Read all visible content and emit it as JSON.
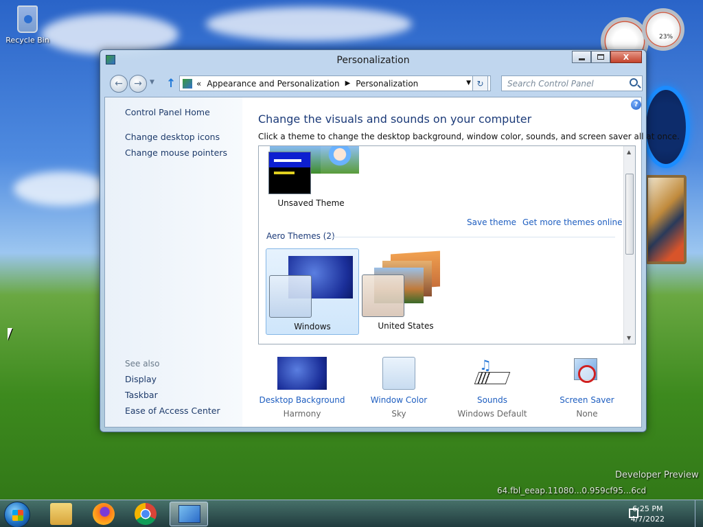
{
  "desktop": {
    "recycle_bin_label": "Recycle Bin",
    "watermark_line1": "Developer Preview",
    "watermark_line2": "64.fbl_eeap.11080...0.959cf95...6cd"
  },
  "window": {
    "title": "Personalization",
    "minimize_label": "▭",
    "maximize_label": "□",
    "close_label": "X"
  },
  "toolbar": {
    "back_icon": "back-arrow-icon",
    "forward_icon": "forward-arrow-icon",
    "breadcrumb_root": "«",
    "breadcrumb_1": "Appearance and Personalization",
    "breadcrumb_sep": "▶",
    "breadcrumb_2": "Personalization",
    "search_placeholder": "Search Control Panel"
  },
  "sidebar": {
    "items": [
      {
        "label": "Control Panel Home"
      },
      {
        "label": "Change desktop icons"
      },
      {
        "label": "Change mouse pointers"
      }
    ],
    "see_also_label": "See also",
    "see_also_items": [
      {
        "label": "Display"
      },
      {
        "label": "Taskbar"
      },
      {
        "label": "Ease of Access Center"
      }
    ]
  },
  "main": {
    "heading": "Change the visuals and sounds on your computer",
    "subtext": "Click a theme to change the desktop background, window color, sounds, and screen saver all at once.",
    "help_label": "?",
    "unsaved_theme_label": "Unsaved Theme",
    "save_theme_link": "Save theme",
    "more_themes_link": "Get more themes online",
    "aero_group_title": "Aero Themes (2)",
    "themes": [
      {
        "label": "Windows",
        "selected": true
      },
      {
        "label": "United States",
        "selected": false
      }
    ]
  },
  "bottom_items": [
    {
      "title": "Desktop Background",
      "sub": "Harmony",
      "icon": "desktop-background-icon"
    },
    {
      "title": "Window Color",
      "sub": "Sky",
      "icon": "window-color-icon"
    },
    {
      "title": "Sounds",
      "sub": "Windows Default",
      "icon": "sounds-icon"
    },
    {
      "title": "Screen Saver",
      "sub": "None",
      "icon": "screen-saver-icon"
    }
  ],
  "gadget": {
    "percent_label": "23%"
  },
  "taskbar": {
    "time": "6:25 PM",
    "date": "4/7/2022",
    "pinned": [
      "file-explorer-icon",
      "firefox-icon",
      "chrome-icon",
      "control-panel-icon"
    ]
  },
  "colors": {
    "link": "#1e5ec0",
    "heading": "#1b3a78",
    "selection": "#cfe6fb"
  }
}
